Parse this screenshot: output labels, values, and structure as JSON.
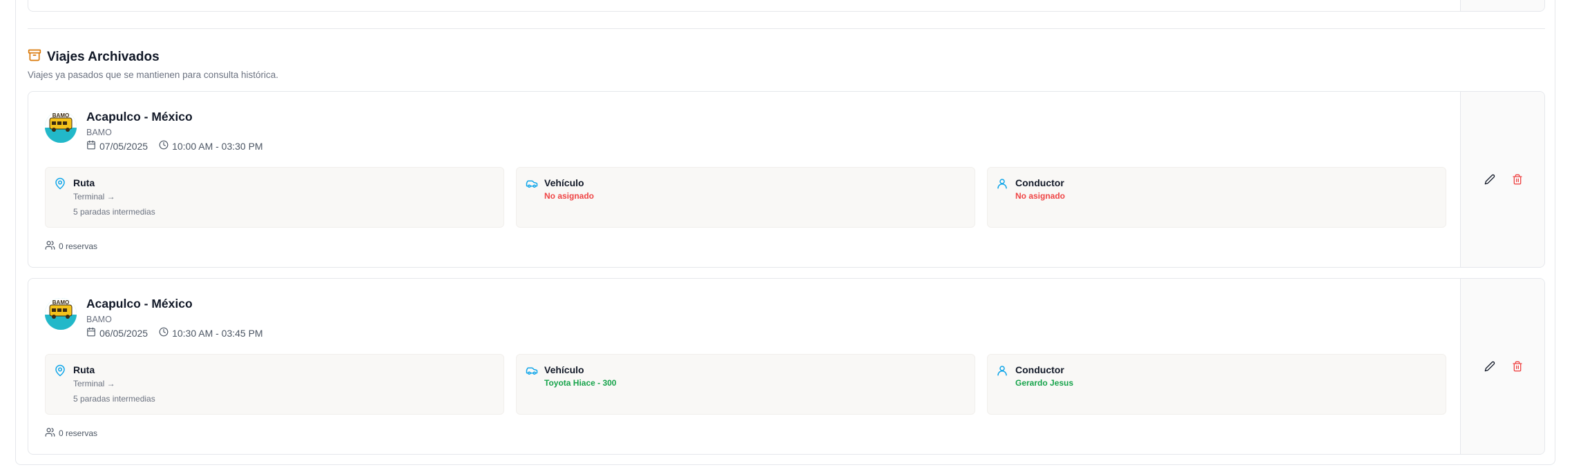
{
  "section": {
    "title": "Viajes Archivados",
    "description": "Viajes ya pasados que se mantienen para consulta histórica.",
    "icon": "archive-icon",
    "accent_color": "#d97706"
  },
  "trips": [
    {
      "name": "Acapulco - México",
      "company": "BAMO",
      "logo_text": "BAMO",
      "date": "07/05/2025",
      "time": "10:00 AM - 03:30 PM",
      "route": {
        "title": "Ruta",
        "origin": "Terminal →",
        "stops": "5 paradas intermedias"
      },
      "vehicle": {
        "title": "Vehículo",
        "value": "No asignado",
        "status": "unassigned"
      },
      "driver": {
        "title": "Conductor",
        "value": "No asignado",
        "status": "unassigned"
      },
      "reservations": "0 reservas"
    },
    {
      "name": "Acapulco - México",
      "company": "BAMO",
      "logo_text": "BAMO",
      "date": "06/05/2025",
      "time": "10:30 AM - 03:45 PM",
      "route": {
        "title": "Ruta",
        "origin": "Terminal →",
        "stops": "5 paradas intermedias"
      },
      "vehicle": {
        "title": "Vehículo",
        "value": "Toyota Hiace - 300",
        "status": "assigned"
      },
      "driver": {
        "title": "Conductor",
        "value": "Gerardo Jesus",
        "status": "assigned"
      },
      "reservations": "0 reservas"
    }
  ],
  "colors": {
    "blue_icon": "#0ea5e9",
    "red_status": "#ef4444",
    "green_status": "#16a34a",
    "delete_icon": "#ef4444"
  }
}
